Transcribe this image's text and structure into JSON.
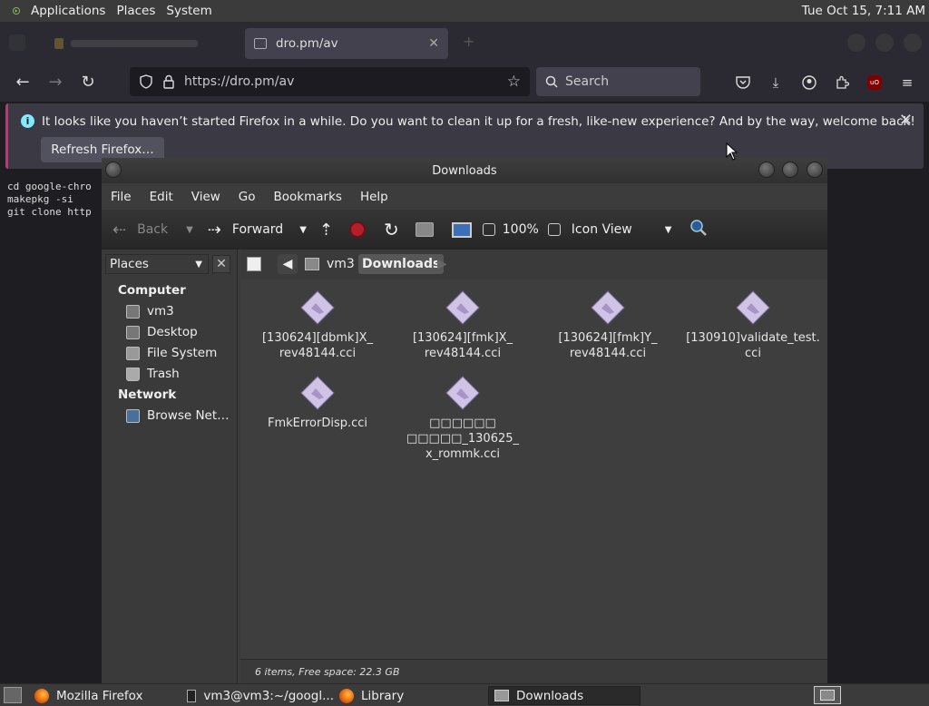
{
  "top_panel": {
    "menus": [
      "Applications",
      "Places",
      "System"
    ],
    "clock": "Tue Oct 15,  7:11 AM"
  },
  "firefox": {
    "active_tab_title": "dro.pm/av",
    "url": "https://dro.pm/av",
    "search_placeholder": "Search",
    "notification": {
      "message": "It looks like you haven’t started Firefox in a while. Do you want to clean it up for a fresh, like-new experience? And by the way, welcome back!",
      "button": "Refresh Firefox…"
    }
  },
  "terminal": {
    "lines": [
      "cd google-chro",
      "makepkg -si",
      "",
      "git clone http"
    ]
  },
  "nautilus": {
    "title": "Downloads",
    "menu": [
      "File",
      "Edit",
      "View",
      "Go",
      "Bookmarks",
      "Help"
    ],
    "toolbar": {
      "back": "Back",
      "forward": "Forward",
      "zoom": "100%",
      "view_mode": "Icon View"
    },
    "sidebar": {
      "selector": "Places",
      "sections": [
        {
          "heading": "Computer",
          "items": [
            "vm3",
            "Desktop",
            "File System",
            "Trash"
          ]
        },
        {
          "heading": "Network",
          "items": [
            "Browse Net…"
          ]
        }
      ]
    },
    "path": {
      "parent": "vm3",
      "current": "Downloads"
    },
    "files": [
      "[130624][dbmk]X_\nrev48144.cci",
      "[130624][fmk]X_\nrev48144.cci",
      "[130624][fmk]Y_\nrev48144.cci",
      "[130910]validate_test.\ncci",
      "FmkErrorDisp.cci",
      "□□□□□□\n□□□□□_130625_\nx_rommk.cci"
    ],
    "status": "6 items, Free space: 22.3 GB"
  },
  "bottom_panel": {
    "tasks": [
      "Mozilla Firefox",
      "vm3@vm3:~/googl...",
      "Library",
      "Downloads"
    ]
  },
  "colors": {
    "accent_notice": "#b13d73",
    "info_icon": "#80ebff",
    "stop_red": "#b3202a"
  }
}
